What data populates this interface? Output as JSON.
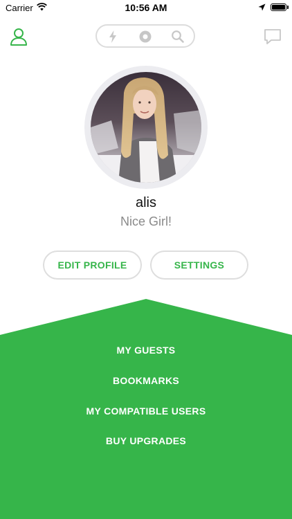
{
  "status_bar": {
    "carrier": "Carrier",
    "time": "10:56 AM",
    "battery_level": 1.0
  },
  "nav": {
    "left_icon": "user-icon",
    "center_icons": [
      "lightning-icon",
      "record-icon",
      "search-icon"
    ],
    "right_icon": "chat-bubble-icon"
  },
  "profile": {
    "name": "alis",
    "status": "Nice Girl!"
  },
  "actions": {
    "edit_profile": "EDIT PROFILE",
    "settings": "SETTINGS"
  },
  "menu": {
    "items": [
      "MY GUESTS",
      "BOOKMARKS",
      "MY COMPATIBLE USERS",
      "BUY UPGRADES"
    ]
  },
  "colors": {
    "accent": "#36b54a",
    "inactive_icon": "#c7c7c7",
    "avatar_ring": "#ececf0"
  }
}
